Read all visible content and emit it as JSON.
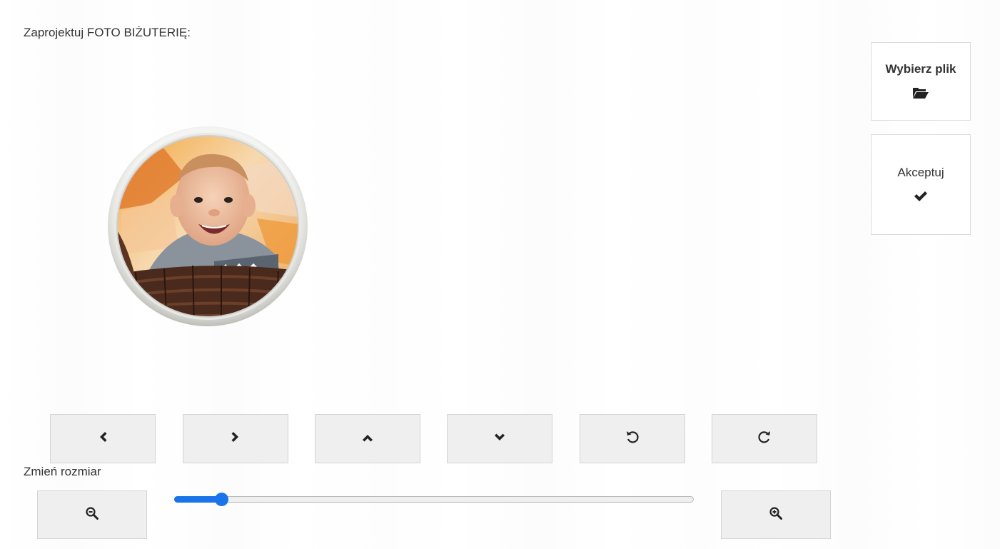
{
  "header": {
    "title": "Zaprojektuj FOTO BIŻUTERIĘ:"
  },
  "side_buttons": {
    "file": {
      "label": "Wybierz plik",
      "icon": "folder-open-icon"
    },
    "accept": {
      "label": "Akceptuj",
      "icon": "check-icon"
    }
  },
  "controls": [
    {
      "name": "move-left-button",
      "icon": "chevron-left-icon"
    },
    {
      "name": "move-right-button",
      "icon": "chevron-right-icon"
    },
    {
      "name": "move-up-button",
      "icon": "chevron-up-icon"
    },
    {
      "name": "move-down-button",
      "icon": "chevron-down-icon"
    },
    {
      "name": "rotate-left-button",
      "icon": "rotate-ccw-icon"
    },
    {
      "name": "rotate-right-button",
      "icon": "rotate-cw-icon"
    }
  ],
  "zoom": {
    "label": "Zmień rozmiar",
    "zoom_out_icon": "zoom-out-icon",
    "zoom_in_icon": "zoom-in-icon",
    "value": 0.09
  },
  "colors": {
    "accent": "#1a73e8",
    "button_bg": "#efefef",
    "text": "#333333"
  }
}
